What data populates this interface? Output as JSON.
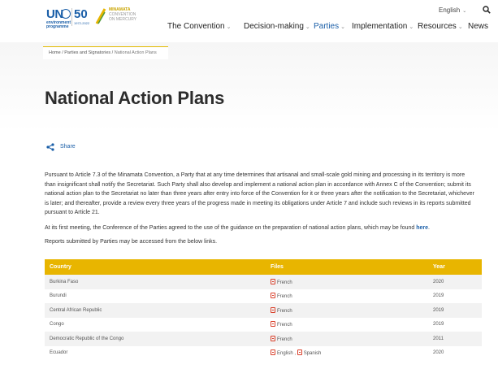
{
  "header": {
    "logo_un": "UN",
    "logo_env_line1": "environment",
    "logo_env_line2": "programme",
    "logo_50": "50",
    "logo_50_sub": "1972-2022",
    "logo_minamata_line1": "MINAMATA",
    "logo_minamata_line2": "CONVENTION",
    "logo_minamata_line3": "ON MERCURY",
    "language": "English",
    "nav": [
      {
        "label": "The Convention",
        "active": false
      },
      {
        "label": "Decision-making",
        "active": false
      },
      {
        "label": "Parties",
        "active": true
      },
      {
        "label": "Implementation",
        "active": false
      },
      {
        "label": "Resources",
        "active": false
      },
      {
        "label": "News",
        "active": false
      }
    ]
  },
  "breadcrumb": {
    "home": "Home",
    "parent": "Parties and Signatories",
    "current": "National Action Plans",
    "sep": " / "
  },
  "page_title": "National Action Plans",
  "share_label": "Share",
  "body": {
    "para1": "Pursuant to Article 7.3 of the Minamata Convention, a Party that at any time determines that artisanal and small-scale gold mining and processing in its territory is more than insignificant shall notify the Secretariat. Such Party shall also develop and implement a national action plan in accordance with Annex C of the Convention; submit its national action plan to the Secretariat no later than three years after entry into force of the Convention for it or three years after the notification to the Secretariat, whichever is later; and thereafter, provide a review every three years of the progress made in meeting its obligations under Article 7 and include such reviews in its reports submitted pursuant to Article 21.",
    "para2_pre": "At its first meeting, the Conference of the Parties agreed to the use of the guidance on the preparation of national action plans, which may be found ",
    "para2_link": "here",
    "para2_post": ".",
    "para3": "Reports submitted by Parties may be accessed from the below links."
  },
  "table": {
    "headers": {
      "country": "Country",
      "files": "Files",
      "year": "Year"
    },
    "rows": [
      {
        "country": "Burkina Faso",
        "files": [
          "French"
        ],
        "year": "2020"
      },
      {
        "country": "Burundi",
        "files": [
          "French"
        ],
        "year": "2019"
      },
      {
        "country": "Central African Republic",
        "files": [
          "French"
        ],
        "year": "2019"
      },
      {
        "country": "Congo",
        "files": [
          "French"
        ],
        "year": "2019"
      },
      {
        "country": "Democratic Republic of the Congo",
        "files": [
          "French"
        ],
        "year": "2011"
      },
      {
        "country": "Ecuador",
        "files": [
          "English",
          "Spanish"
        ],
        "year": "2020"
      }
    ],
    "file_separator": " , "
  },
  "colors": {
    "accent_blue": "#1b5fa8",
    "header_gold": "#e8b500",
    "pdf_red": "#d9402b"
  }
}
